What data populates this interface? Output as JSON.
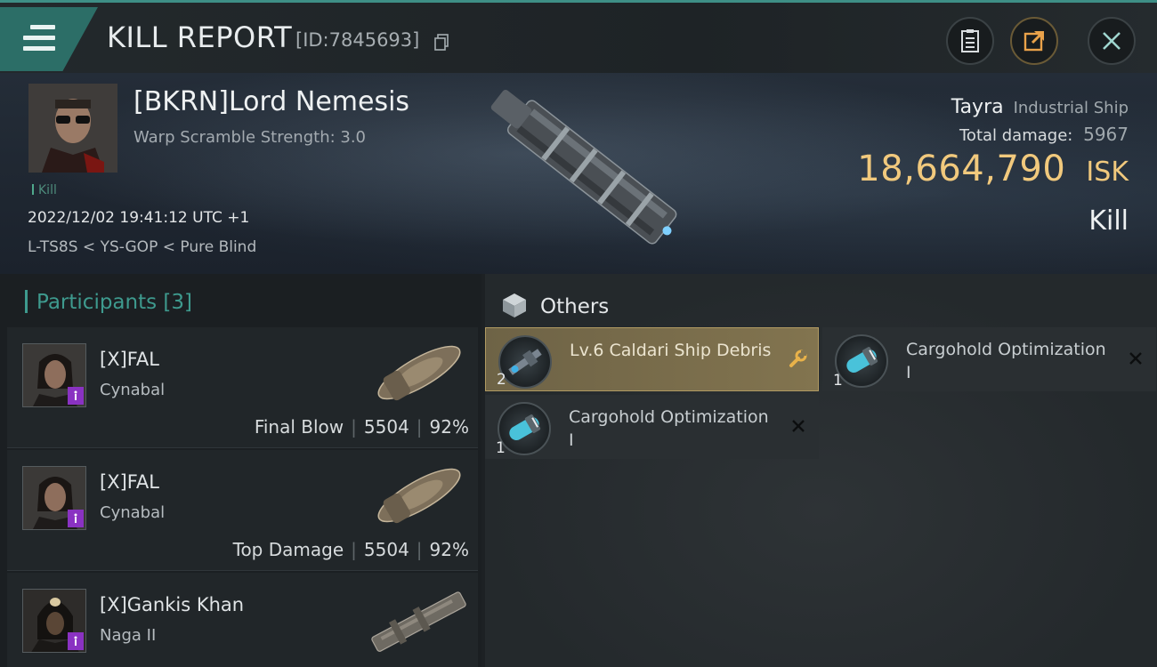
{
  "header": {
    "title": "KILL REPORT",
    "report_id": "[ID:7845693]",
    "icons": [
      "menu-icon",
      "copy-icon",
      "clipboard-icon",
      "share-icon",
      "close-icon"
    ]
  },
  "victim": {
    "name": "[BKRN]Lord Nemesis",
    "warp_scramble": "Warp Scramble Strength: 3.0",
    "tag": "Kill",
    "datetime": "2022/12/02 19:41:12 UTC +1",
    "location": "L-TS8S < YS-GOP < Pure Blind",
    "ship_name": "Tayra",
    "ship_class": "Industrial Ship",
    "total_damage_label": "Total damage:",
    "total_damage": "5967",
    "isk_value": "18,664,790",
    "isk_unit": "ISK",
    "status": "Kill"
  },
  "participants": {
    "title": "Participants [3]",
    "rows": [
      {
        "name": "[X]FAL",
        "ship": "Cynabal",
        "role": "Final Blow",
        "damage": "5504",
        "percent": "92%"
      },
      {
        "name": "[X]FAL",
        "ship": "Cynabal",
        "role": "Top Damage",
        "damage": "5504",
        "percent": "92%"
      },
      {
        "name": "[X]Gankis Khan",
        "ship": "Naga II",
        "role": "",
        "damage": "",
        "percent": ""
      }
    ]
  },
  "others": {
    "title": "Others",
    "items": [
      {
        "name": "Lv.6 Caldari Ship Debris",
        "qty": "2",
        "selected": true,
        "action_icon": "wrench-icon"
      },
      {
        "name": "Cargohold Optimization I",
        "qty": "1",
        "selected": false,
        "action_icon": "x-icon"
      },
      {
        "name": "Cargohold Optimization I",
        "qty": "1",
        "selected": false,
        "action_icon": "x-icon"
      }
    ]
  },
  "colors": {
    "accent": "#3e9a8e",
    "isk": "#f1c97d",
    "selected_item": "#82744f"
  }
}
